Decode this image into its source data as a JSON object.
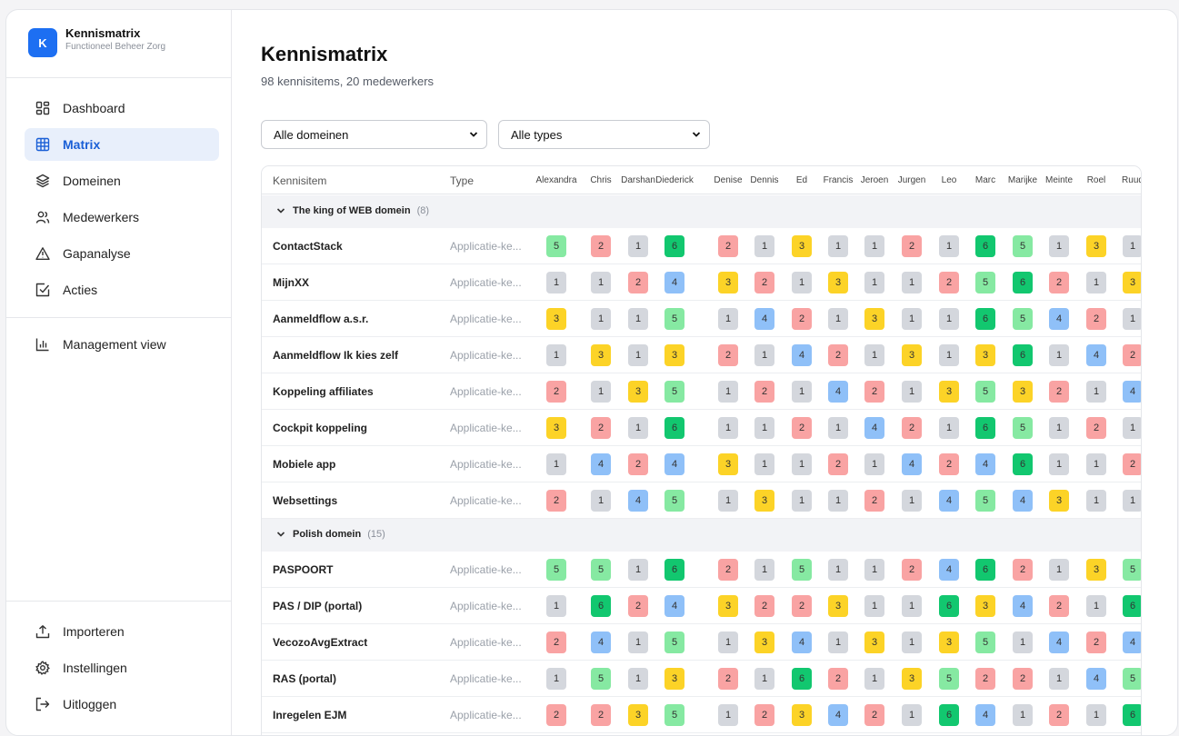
{
  "brand": {
    "logo_letter": "K",
    "title": "Kennismatrix",
    "subtitle": "Functioneel Beheer Zorg"
  },
  "nav": {
    "items": [
      {
        "label": "Dashboard",
        "icon": "dashboard-icon",
        "active": false
      },
      {
        "label": "Matrix",
        "icon": "grid-icon",
        "active": true
      },
      {
        "label": "Domeinen",
        "icon": "layers-icon",
        "active": false
      },
      {
        "label": "Medewerkers",
        "icon": "users-icon",
        "active": false
      },
      {
        "label": "Gapanalyse",
        "icon": "warning-icon",
        "active": false
      },
      {
        "label": "Acties",
        "icon": "checkbox-icon",
        "active": false
      }
    ],
    "management": {
      "label": "Management view",
      "icon": "bar-chart-icon"
    },
    "bottom": [
      {
        "label": "Importeren",
        "icon": "upload-icon"
      },
      {
        "label": "Instellingen",
        "icon": "settings-icon"
      },
      {
        "label": "Uitloggen",
        "icon": "logout-icon"
      }
    ]
  },
  "page": {
    "title": "Kennismatrix",
    "subtitle": "98 kennisitems, 20 medewerkers"
  },
  "filters": {
    "domain_selected": "Alle domeinen",
    "type_selected": "Alle types"
  },
  "table": {
    "col_item": "Kennisitem",
    "col_type": "Type",
    "employees": [
      "Alexandra",
      "Chris",
      "Darshan",
      "Diederick",
      "Denise",
      "Dennis",
      "Ed",
      "Francis",
      "Jeroen",
      "Jurgen",
      "Leo",
      "Marc",
      "Marijke",
      "Meinte",
      "Roel",
      "Ruud"
    ],
    "groups": [
      {
        "name": "The king of WEB domein",
        "count": "(8)",
        "rows": [
          {
            "name": "ContactStack",
            "type": "Applicatie-ke...",
            "scores": [
              5,
              2,
              1,
              6,
              2,
              1,
              3,
              1,
              1,
              2,
              1,
              6,
              5,
              1,
              3,
              1
            ]
          },
          {
            "name": "MijnXX",
            "type": "Applicatie-ke...",
            "scores": [
              1,
              1,
              2,
              4,
              3,
              2,
              1,
              3,
              1,
              1,
              2,
              5,
              6,
              2,
              1,
              3
            ]
          },
          {
            "name": "Aanmeldflow a.s.r.",
            "type": "Applicatie-ke...",
            "scores": [
              3,
              1,
              1,
              5,
              1,
              4,
              2,
              1,
              3,
              1,
              1,
              6,
              5,
              4,
              2,
              1
            ]
          },
          {
            "name": "Aanmeldflow Ik kies zelf",
            "type": "Applicatie-ke...",
            "scores": [
              1,
              3,
              1,
              3,
              2,
              1,
              4,
              2,
              1,
              3,
              1,
              3,
              6,
              1,
              4,
              2
            ]
          },
          {
            "name": "Koppeling affiliates",
            "type": "Applicatie-ke...",
            "scores": [
              2,
              1,
              3,
              5,
              1,
              2,
              1,
              4,
              2,
              1,
              3,
              5,
              3,
              2,
              1,
              4
            ]
          },
          {
            "name": "Cockpit koppeling",
            "type": "Applicatie-ke...",
            "scores": [
              3,
              2,
              1,
              6,
              1,
              1,
              2,
              1,
              4,
              2,
              1,
              6,
              5,
              1,
              2,
              1
            ]
          },
          {
            "name": "Mobiele app",
            "type": "Applicatie-ke...",
            "scores": [
              1,
              4,
              2,
              4,
              3,
              1,
              1,
              2,
              1,
              4,
              2,
              4,
              6,
              1,
              1,
              2
            ]
          },
          {
            "name": "Websettings",
            "type": "Applicatie-ke...",
            "scores": [
              2,
              1,
              4,
              5,
              1,
              3,
              1,
              1,
              2,
              1,
              4,
              5,
              4,
              3,
              1,
              1
            ]
          }
        ]
      },
      {
        "name": "Polish domein",
        "count": "(15)",
        "rows": [
          {
            "name": "PASPOORT",
            "type": "Applicatie-ke...",
            "scores": [
              5,
              5,
              1,
              6,
              2,
              1,
              5,
              1,
              1,
              2,
              4,
              6,
              2,
              1,
              3,
              5
            ]
          },
          {
            "name": "PAS / DIP (portal)",
            "type": "Applicatie-ke...",
            "scores": [
              1,
              6,
              2,
              4,
              3,
              2,
              2,
              3,
              1,
              1,
              6,
              3,
              4,
              2,
              1,
              6
            ]
          },
          {
            "name": "VecozoAvgExtract",
            "type": "Applicatie-ke...",
            "scores": [
              2,
              4,
              1,
              5,
              1,
              3,
              4,
              1,
              3,
              1,
              3,
              5,
              1,
              4,
              2,
              4
            ]
          },
          {
            "name": "RAS (portal)",
            "type": "Applicatie-ke...",
            "scores": [
              1,
              5,
              1,
              3,
              2,
              1,
              6,
              2,
              1,
              3,
              5,
              2,
              2,
              1,
              4,
              5
            ]
          },
          {
            "name": "Inregelen EJM",
            "type": "Applicatie-ke...",
            "scores": [
              2,
              2,
              3,
              5,
              1,
              2,
              3,
              4,
              2,
              1,
              6,
              4,
              1,
              2,
              1,
              6
            ]
          }
        ]
      }
    ]
  },
  "score_colors": {
    "1": "#d4d7dd",
    "2": "#f9a3a3",
    "3": "#fcd327",
    "4": "#8fc0f8",
    "5": "#86e9a2",
    "6": "#12c76f"
  }
}
